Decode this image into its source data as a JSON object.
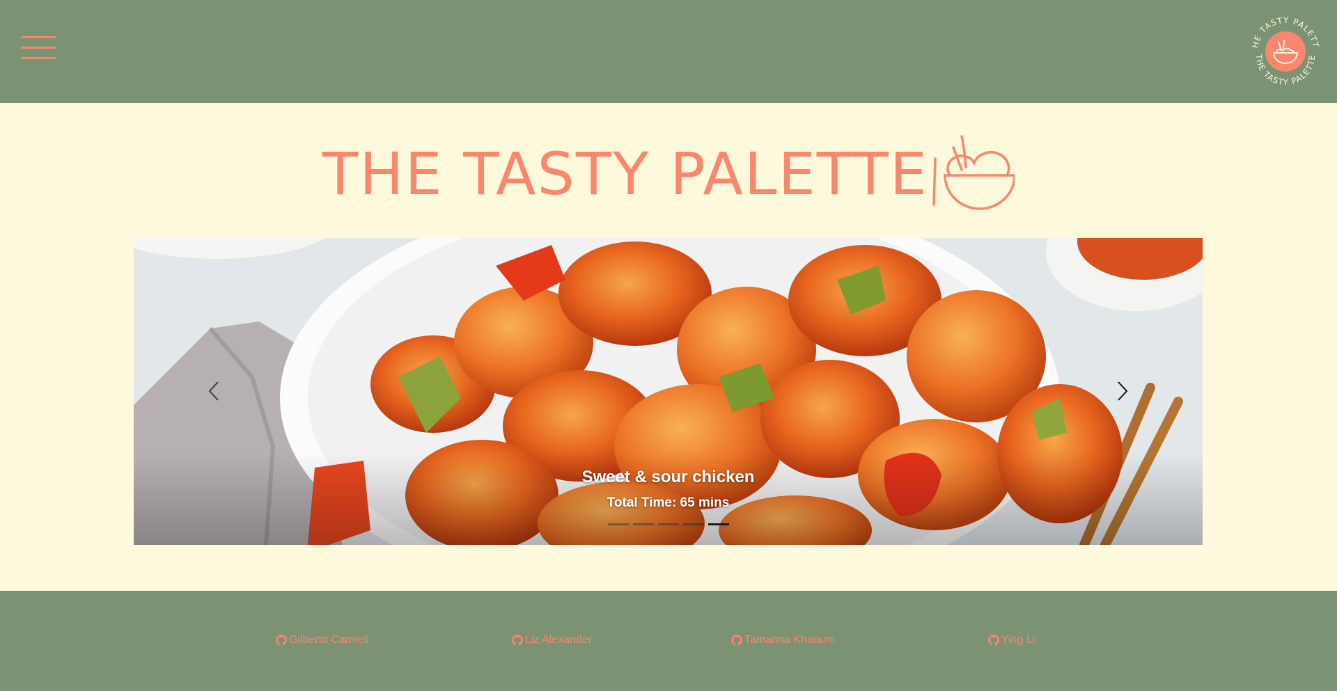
{
  "header": {
    "menu_icon": "hamburger-menu-icon",
    "logo_text": "THE TASTY PALETTE",
    "accent_color": "#f8876e",
    "bar_color": "#7b9273"
  },
  "main": {
    "site_title": "THE TASTY PALETTE",
    "title_icon": "bowl-with-chopsticks-icon",
    "background_color": "#fef9dc"
  },
  "carousel": {
    "slide": {
      "title": "Sweet & sour chicken",
      "total_time": "Total Time: 65 mins",
      "image": "sweet-and-sour-chicken-photo"
    },
    "prev_icon": "chevron-left-icon",
    "next_icon": "chevron-right-icon",
    "indicator_count": 5,
    "active_indicator": 5
  },
  "footer": {
    "contributors": [
      {
        "name": "Gilberto Carnieli",
        "icon": "github-icon"
      },
      {
        "name": "Liz Alexander",
        "icon": "github-icon"
      },
      {
        "name": "Tamanna Khanum",
        "icon": "github-icon"
      },
      {
        "name": "Ying Li",
        "icon": "github-icon"
      }
    ]
  }
}
